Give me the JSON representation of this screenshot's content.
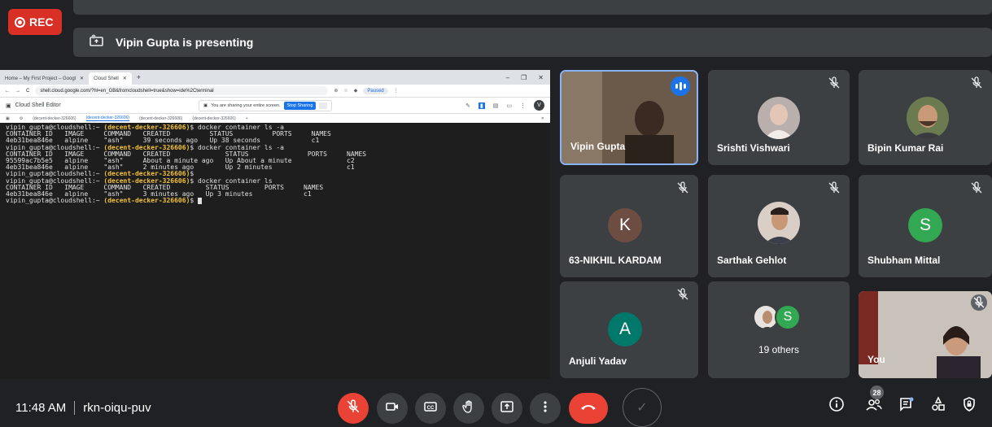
{
  "rec": {
    "label": "REC"
  },
  "presenting": {
    "text": "Vipin Gupta is presenting"
  },
  "browser": {
    "tabs": [
      "Home – My First Project – Googl",
      "Cloud Shell"
    ],
    "url": "shell.cloud.google.com/?hl=en_GB&fromcloudshell=true&show=ide%2Cterminal",
    "paused": "Paused",
    "editor_title": "Cloud Shell Editor",
    "share_notice": "You are sharing your entire screen.",
    "stop_sharing": "Stop Sharing",
    "term_tabs": [
      "(decent-decker-326606)",
      "(decent-decker-326606)",
      "(decent-decker-326606)",
      "(decent-decker-326606)"
    ],
    "avatar_letter": "V"
  },
  "terminal": {
    "prompt": "vipin_gupta@cloudshell:~",
    "project": "(decent-decker-326606)",
    "lines": [
      {
        "t": "cmd",
        "c": "$ docker container ls -a"
      },
      {
        "t": "out",
        "c": "CONTAINER ID   IMAGE     COMMAND   CREATED          STATUS          PORTS     NAMES"
      },
      {
        "t": "out",
        "c": "4eb31bea846e   alpine    \"ash\"     39 seconds ago   Up 38 seconds             c1"
      },
      {
        "t": "cmd",
        "c": "$ docker container ls -a"
      },
      {
        "t": "out",
        "c": "CONTAINER ID   IMAGE     COMMAND   CREATED              STATUS               PORTS     NAMES"
      },
      {
        "t": "out",
        "c": "95599ac7b5e5   alpine    \"ash\"     About a minute ago   Up About a minute              c2"
      },
      {
        "t": "out",
        "c": "4eb31bea846e   alpine    \"ash\"     2 minutes ago        Up 2 minutes                   c1"
      },
      {
        "t": "cmd",
        "c": "$"
      },
      {
        "t": "cmd",
        "c": "$ docker container ls"
      },
      {
        "t": "out",
        "c": "CONTAINER ID   IMAGE     COMMAND   CREATED         STATUS         PORTS     NAMES"
      },
      {
        "t": "out",
        "c": "4eb31bea846e   alpine    \"ash\"     3 minutes ago   Up 3 minutes             c1"
      },
      {
        "t": "last",
        "c": "$ "
      }
    ]
  },
  "participants": [
    {
      "name": "Vipin Gupta",
      "kind": "video",
      "speaking": true
    },
    {
      "name": "Srishti Vishwari",
      "kind": "photo",
      "muted": true
    },
    {
      "name": "Bipin Kumar Rai",
      "kind": "photo",
      "muted": true
    },
    {
      "name": "63-NIKHIL KARDAM",
      "kind": "letter",
      "letter": "K",
      "color": "#6d4c41",
      "muted": true
    },
    {
      "name": "Sarthak Gehlot",
      "kind": "photo",
      "muted": true
    },
    {
      "name": "Shubham Mittal",
      "kind": "letter",
      "letter": "S",
      "color": "#33a852",
      "muted": true
    },
    {
      "name": "Anjuli Yadav",
      "kind": "letter",
      "letter": "A",
      "color": "#00796b",
      "muted": true
    },
    {
      "name": "19 others",
      "kind": "others",
      "letter": "S",
      "color": "#33a852"
    },
    {
      "name": "You",
      "kind": "self",
      "muted": true
    }
  ],
  "meeting": {
    "time": "11:48 AM",
    "code": "rkn-oiqu-puv"
  },
  "people_count": "28",
  "colors": {
    "bg": "#202124",
    "tile": "#3c4043",
    "red": "#ea4335",
    "blue": "#1a73e8"
  }
}
